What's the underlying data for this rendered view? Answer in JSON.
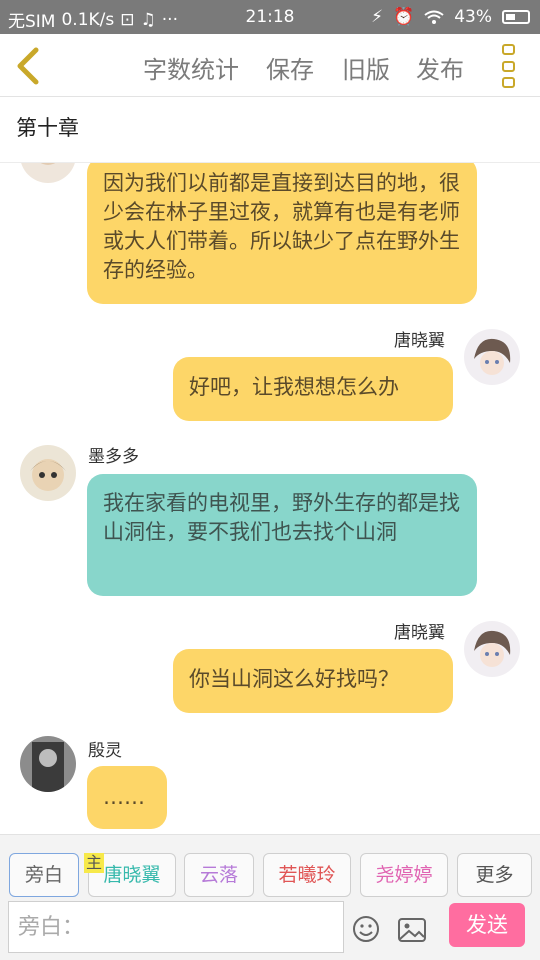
{
  "status_bar": {
    "sim": "无SIM",
    "speed": "0.1K/s",
    "time": "21:18",
    "battery": "43%"
  },
  "app_bar": {
    "word_count": "字数统计",
    "save": "保存",
    "old_version": "旧版",
    "publish": "发布"
  },
  "chapter": {
    "title": "第十章"
  },
  "messages": [
    {
      "speaker": "",
      "text": "因为我们以前都是直接到达目的地，很少会在林子里过夜，就算有也是有老师或大人们带着。所以缺少了点在野外生存的经验。"
    },
    {
      "speaker": "唐晓翼",
      "text": "好吧，让我想想怎么办"
    },
    {
      "speaker": "墨多多",
      "text": "我在家看的电视里，野外生存的都是找山洞住，要不我们也去找个山洞"
    },
    {
      "speaker": "唐晓翼",
      "text": "你当山洞这么好找吗？"
    },
    {
      "speaker": "殷灵",
      "text": "……"
    }
  ],
  "bottom": {
    "tabs": [
      "旁白",
      "唐晓翼",
      "云落",
      "若曦玲",
      "尧婷婷",
      "更多"
    ],
    "main_badge": "主",
    "input_placeholder": "旁白：",
    "send": "发送"
  },
  "colors": {
    "yellow_bubble": "#fdd668",
    "teal_bubble": "#88d6cb",
    "send_button": "#ff6da0",
    "accent": "#c9a82a"
  },
  "icons": [
    "back-chevron-icon",
    "more-icon",
    "emoji-icon",
    "image-icon"
  ]
}
